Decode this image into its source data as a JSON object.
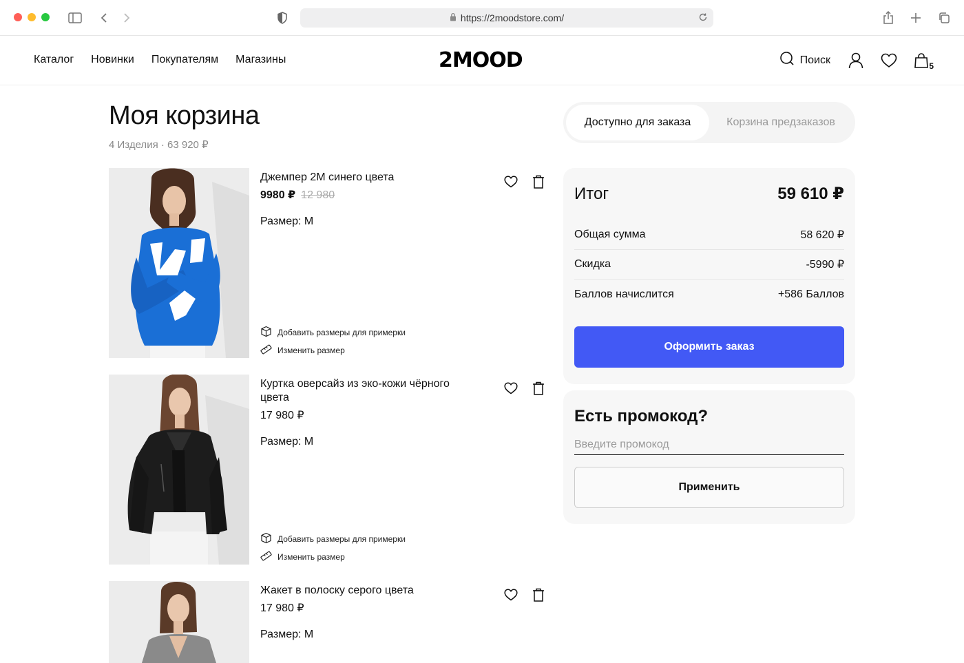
{
  "browser": {
    "url": "https://2moodstore.com/"
  },
  "header": {
    "nav": [
      "Каталог",
      "Новинки",
      "Покупателям",
      "Магазины"
    ],
    "logo": "2MOOD",
    "search_label": "Поиск",
    "cart_count": "5"
  },
  "page": {
    "title": "Моя корзина",
    "subtitle": "4 Изделия · 63 920 ₽"
  },
  "tabs": {
    "active": "Доступно для заказа",
    "inactive": "Корзина предзаказов"
  },
  "products": [
    {
      "name": "Джемпер 2М синего цвета",
      "price": "9980 ₽",
      "old_price": "12 980",
      "size": "Размер: M",
      "action_fit": "Добавить размеры для примерки",
      "action_size": "Изменить размер"
    },
    {
      "name": "Куртка оверсайз из эко-кожи чёрного цвета",
      "price": "17 980 ₽",
      "size": "Размер: M",
      "action_fit": "Добавить размеры для примерки",
      "action_size": "Изменить размер"
    },
    {
      "name": "Жакет в полоску серого цвета",
      "price": "17 980 ₽",
      "size": "Размер: M"
    }
  ],
  "summary": {
    "title": "Итог",
    "total": "59 610 ₽",
    "rows": [
      {
        "label": "Общая сумма",
        "value": "58 620 ₽"
      },
      {
        "label": "Скидка",
        "value": "-5990 ₽"
      },
      {
        "label": "Баллов начислится",
        "value": "+586 Баллов"
      }
    ],
    "checkout_label": "Оформить заказ"
  },
  "promo": {
    "title": "Есть промокод?",
    "placeholder": "Введите промокод",
    "apply_label": "Применить"
  },
  "colors": {
    "accent": "#4259f5",
    "sweater": "#1a6fd6",
    "jacket": "#1c1c1c"
  }
}
